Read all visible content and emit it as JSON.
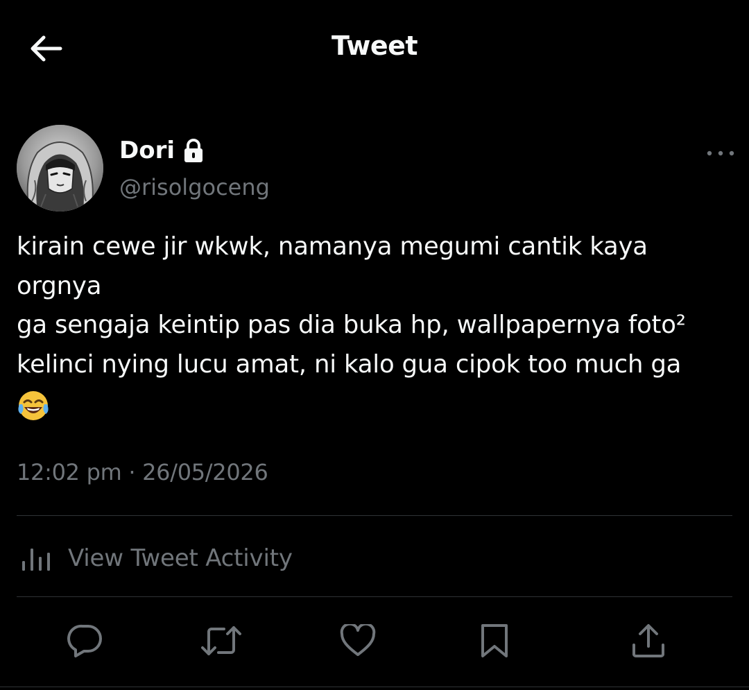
{
  "header": {
    "title": "Tweet",
    "back_icon": "arrow-left-icon"
  },
  "tweet": {
    "author": {
      "name": "Dori",
      "handle": "@risolgoceng",
      "protected_icon": "lock-icon",
      "avatar": "avatar-image"
    },
    "more_icon": "more-horizontal-icon",
    "text_lines": [
      "kirain cewe jir wkwk, namanya megumi cantik kaya",
      "orgnya",
      "ga sengaja keintip pas dia buka hp, wallpapernya foto²",
      "kelinci nying lucu amat, ni kalo gua cipok too much ga",
      "😂"
    ],
    "timestamp": "12:02 pm · 26/05/2026"
  },
  "activity": {
    "label": "View Tweet Activity",
    "icon": "bar-chart-icon"
  },
  "actions": [
    {
      "name": "reply",
      "icon": "reply-icon"
    },
    {
      "name": "retweet",
      "icon": "retweet-icon"
    },
    {
      "name": "like",
      "icon": "heart-icon"
    },
    {
      "name": "bookmark",
      "icon": "bookmark-icon"
    },
    {
      "name": "share",
      "icon": "share-icon"
    }
  ],
  "colors": {
    "background": "#000000",
    "primary_text": "#f7f9f9",
    "secondary_text": "#71767b",
    "divider": "#2f3336"
  }
}
